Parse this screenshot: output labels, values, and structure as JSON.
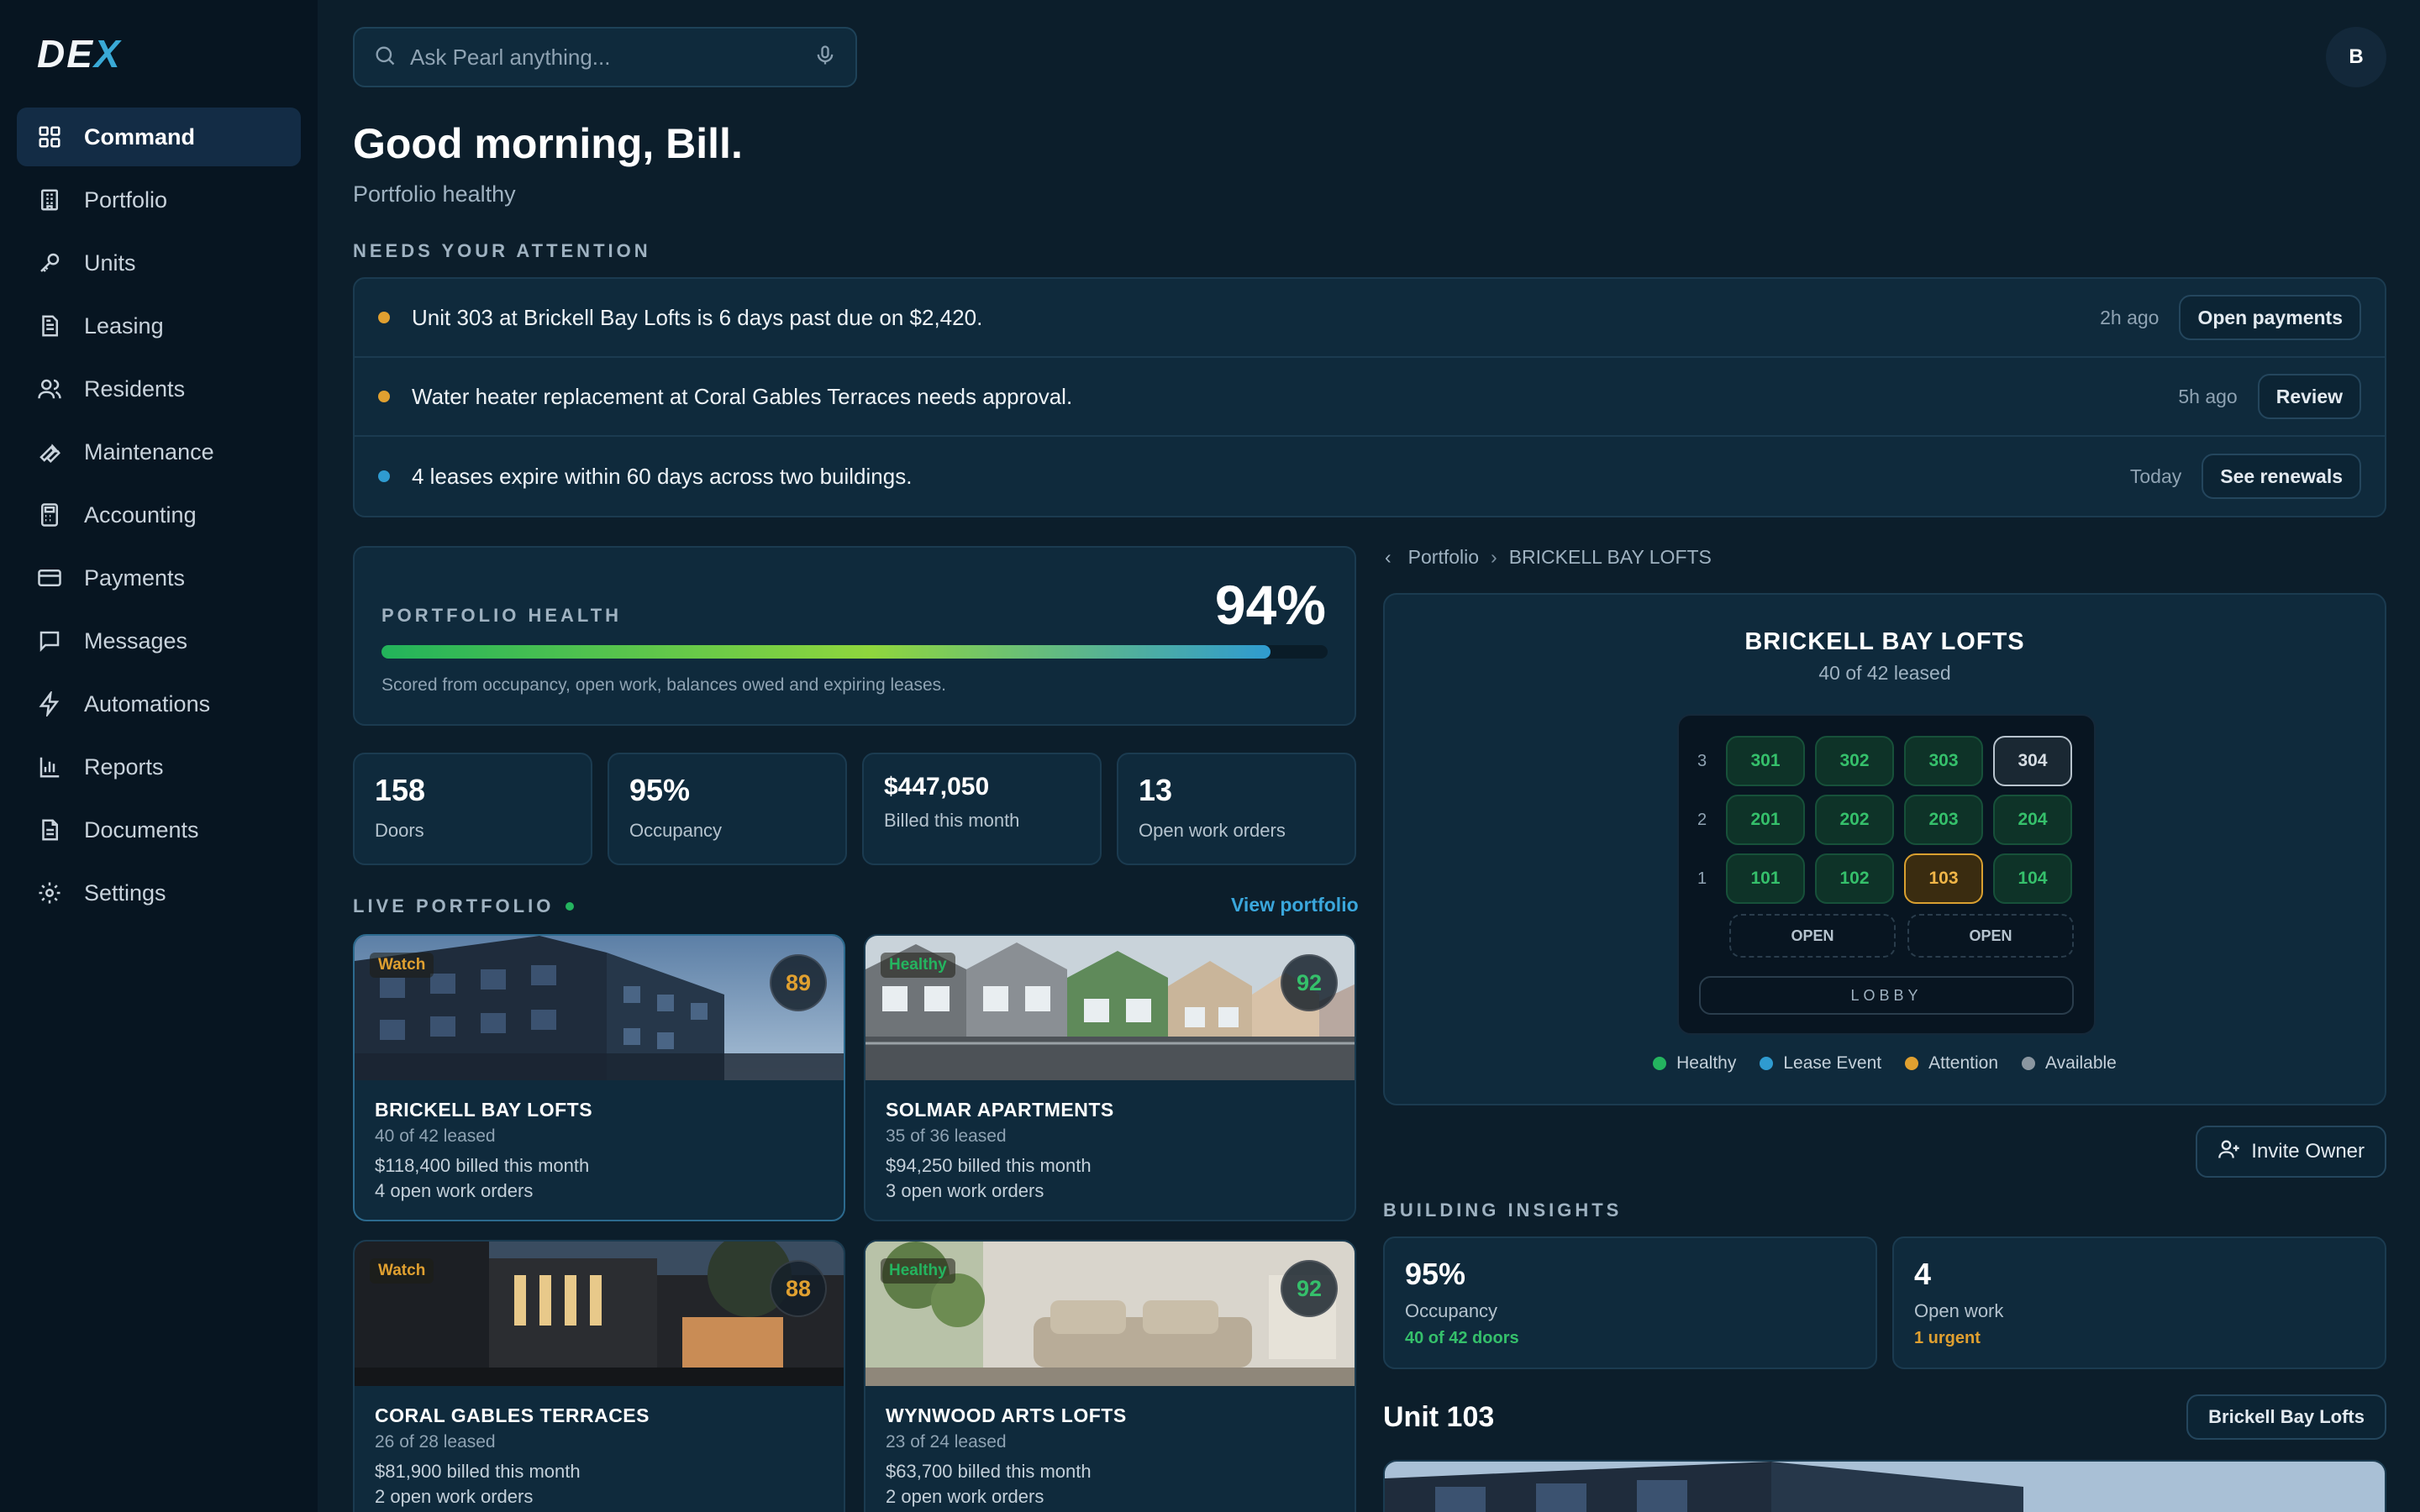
{
  "brand": {
    "logo": "DE",
    "logo_x": "X"
  },
  "sidebar": {
    "items": [
      {
        "label": "Command",
        "icon": "grid-icon",
        "active": true
      },
      {
        "label": "Portfolio",
        "icon": "building-icon"
      },
      {
        "label": "Units",
        "icon": "key-icon"
      },
      {
        "label": "Leasing",
        "icon": "document-icon"
      },
      {
        "label": "Residents",
        "icon": "users-icon"
      },
      {
        "label": "Maintenance",
        "icon": "wrench-icon"
      },
      {
        "label": "Accounting",
        "icon": "calculator-icon"
      },
      {
        "label": "Payments",
        "icon": "credit-card-icon"
      },
      {
        "label": "Messages",
        "icon": "chat-icon"
      },
      {
        "label": "Automations",
        "icon": "lightning-icon"
      },
      {
        "label": "Reports",
        "icon": "bar-chart-icon"
      },
      {
        "label": "Documents",
        "icon": "file-icon"
      },
      {
        "label": "Settings",
        "icon": "gear-icon"
      }
    ]
  },
  "search": {
    "placeholder": "Ask Pearl anything..."
  },
  "user": {
    "initial": "B"
  },
  "header": {
    "greeting": "Good morning, Bill.",
    "status": "Portfolio healthy"
  },
  "attention": {
    "label": "NEEDS YOUR ATTENTION",
    "items": [
      {
        "text": "Unit 303 at Brickell Bay Lofts is 6 days past due on $2,420.",
        "time": "2h ago",
        "action": "Open payments",
        "color": "#e0a030"
      },
      {
        "text": "Water heater replacement at Coral Gables Terraces needs approval.",
        "time": "5h ago",
        "action": "Review",
        "color": "#e0a030"
      },
      {
        "text": "4 leases expire within 60 days across two buildings.",
        "time": "Today",
        "action": "See renewals",
        "color": "#2f9bd0"
      }
    ]
  },
  "health": {
    "label": "PORTFOLIO HEALTH",
    "value": "94%",
    "fraction": 0.94,
    "note": "Scored from occupancy, open work, balances owed and expiring leases."
  },
  "stats": [
    {
      "value": "158",
      "label": "Doors"
    },
    {
      "value": "95%",
      "label": "Occupancy"
    },
    {
      "value": "$447,050",
      "label": "Billed this month"
    },
    {
      "value": "13",
      "label": "Open work orders"
    }
  ],
  "live": {
    "label": "LIVE PORTFOLIO",
    "view_link": "View portfolio"
  },
  "properties": [
    {
      "name": "BRICKELL BAY LOFTS",
      "leased": "40 of 42 leased",
      "billed": "$118,400 billed this month",
      "work": "4 open work orders",
      "badge": "Watch",
      "badge_color": "#e0a030",
      "score": "89",
      "score_color": "#e0a030"
    },
    {
      "name": "SOLMAR APARTMENTS",
      "leased": "35 of 36 leased",
      "billed": "$94,250 billed this month",
      "work": "3 open work orders",
      "badge": "Healthy",
      "badge_color": "#24b45f",
      "score": "92",
      "score_color": "#35c06b"
    },
    {
      "name": "CORAL GABLES TERRACES",
      "leased": "26 of 28 leased",
      "billed": "$81,900 billed this month",
      "work": "2 open work orders",
      "badge": "Watch",
      "badge_color": "#e0a030",
      "score": "88",
      "score_color": "#e0a030"
    },
    {
      "name": "WYNWOOD ARTS LOFTS",
      "leased": "23 of 24 leased",
      "billed": "$63,700 billed this month",
      "work": "2 open work orders",
      "badge": "Healthy",
      "badge_color": "#24b45f",
      "score": "92",
      "score_color": "#35c06b"
    }
  ],
  "breadcrumb": {
    "root": "Portfolio",
    "current": "BRICKELL BAY LOFTS"
  },
  "building": {
    "name": "BRICKELL BAY LOFTS",
    "leased": "40 of 42 leased",
    "floors": [
      {
        "number": "3",
        "units": [
          {
            "id": "301",
            "state": "healthy"
          },
          {
            "id": "302",
            "state": "healthy"
          },
          {
            "id": "303",
            "state": "healthy"
          },
          {
            "id": "304",
            "state": "available"
          }
        ]
      },
      {
        "number": "2",
        "units": [
          {
            "id": "201",
            "state": "healthy"
          },
          {
            "id": "202",
            "state": "healthy"
          },
          {
            "id": "203",
            "state": "healthy"
          },
          {
            "id": "204",
            "state": "healthy"
          }
        ]
      },
      {
        "number": "1",
        "units": [
          {
            "id": "101",
            "state": "healthy"
          },
          {
            "id": "102",
            "state": "healthy"
          },
          {
            "id": "103",
            "state": "attention"
          },
          {
            "id": "104",
            "state": "healthy"
          }
        ]
      }
    ],
    "open_label": "OPEN",
    "lobby_label": "LOBBY",
    "legend": [
      {
        "label": "Healthy",
        "color": "#24b45f"
      },
      {
        "label": "Lease Event",
        "color": "#2f9bd0"
      },
      {
        "label": "Attention",
        "color": "#e0a030"
      },
      {
        "label": "Available",
        "color": "#8a96a0"
      }
    ]
  },
  "invite": {
    "label": "Invite Owner"
  },
  "insights": {
    "label": "BUILDING INSIGHTS",
    "cards": [
      {
        "value": "95%",
        "label": "Occupancy",
        "note": "40 of 42 doors",
        "note_color": "#35c06b"
      },
      {
        "value": "4",
        "label": "Open work",
        "note": "1 urgent",
        "note_color": "#e0a030"
      }
    ]
  },
  "unit_detail": {
    "title": "Unit 103",
    "building_tag": "Brickell Bay Lofts"
  }
}
